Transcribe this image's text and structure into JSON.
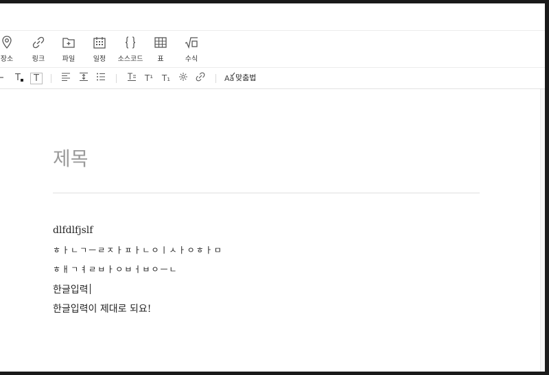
{
  "toolbar": {
    "items": [
      {
        "label": "장소",
        "icon": "location-pin-icon"
      },
      {
        "label": "링크",
        "icon": "link-icon"
      },
      {
        "label": "파일",
        "icon": "file-add-icon"
      },
      {
        "label": "일정",
        "icon": "calendar-icon"
      },
      {
        "label": "소스코드",
        "icon": "code-braces-icon"
      },
      {
        "label": "표",
        "icon": "table-icon"
      },
      {
        "label": "수식",
        "icon": "formula-icon"
      }
    ]
  },
  "format_bar": {
    "spellcheck_label": "맞춤법",
    "glyphs": {
      "text_color": "T",
      "text_bg": "T",
      "superscript": "T¹",
      "subscript": "T₁"
    }
  },
  "editor": {
    "title_placeholder": "제목",
    "lines": [
      "dlfdlfjslf",
      "ㅎㅏㄴㄱㅡㄹㅈㅏㅍㅏㄴㅇㅣㅅㅏㅇㅎㅏㅁ",
      "ㅎㅐㄱㅕㄹㅂㅏㅇㅂㅓㅂㅇㅡㄴ",
      "한글입력",
      "한글입력이 제대로 되요!"
    ]
  }
}
